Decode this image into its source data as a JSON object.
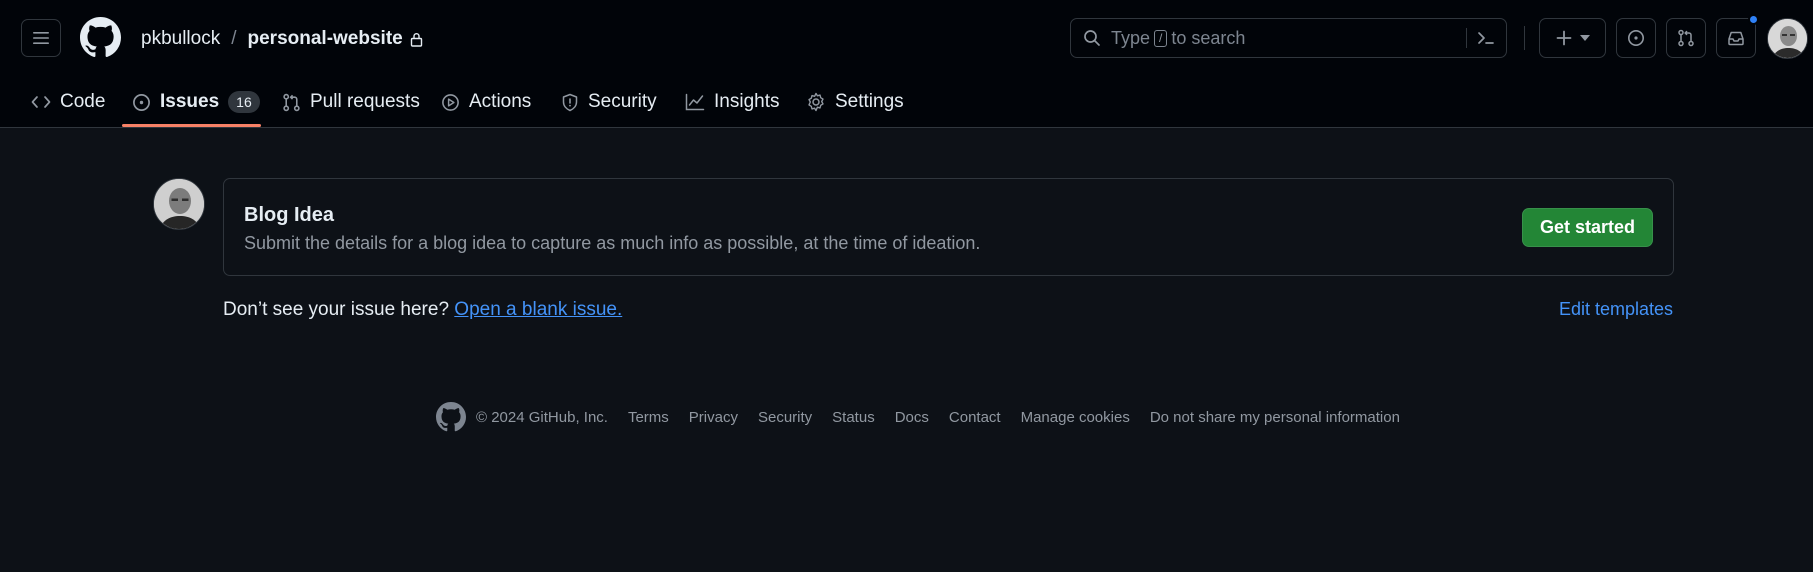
{
  "colors": {
    "header_bg": "#010409",
    "page_bg": "#0d1117",
    "border": "#30363d",
    "link": "#4493f8",
    "primary_button": "#238636",
    "active_tab_underline": "#f78166",
    "notification_dot": "#2f81f7"
  },
  "header": {
    "owner": "pkbullock",
    "separator": "/",
    "repo": "personal-website",
    "search": {
      "prefix": "Type",
      "key": "/",
      "suffix": "to search"
    }
  },
  "icons": {
    "menu": "hamburger-icon",
    "logo": "github-mark-icon",
    "lock": "lock-icon",
    "search": "search-icon",
    "command": "command-palette-icon",
    "create": "plus-icon",
    "issues": "issue-opened-icon",
    "pulls": "git-pull-request-icon",
    "inbox": "inbox-icon"
  },
  "tabs": [
    {
      "label": "Code",
      "icon": "code-icon"
    },
    {
      "label": "Issues",
      "icon": "issue-opened-icon",
      "count": "16",
      "active": true
    },
    {
      "label": "Pull requests",
      "icon": "git-pull-request-icon"
    },
    {
      "label": "Actions",
      "icon": "play-icon"
    },
    {
      "label": "Security",
      "icon": "shield-icon"
    },
    {
      "label": "Insights",
      "icon": "graph-icon"
    },
    {
      "label": "Settings",
      "icon": "gear-icon"
    }
  ],
  "template": {
    "title": "Blog Idea",
    "description": "Submit the details for a blog idea to capture as much info as possible, at the time of ideation.",
    "button": "Get started"
  },
  "blank_issue": {
    "prompt": "Don’t see your issue here?",
    "link": "Open a blank issue."
  },
  "edit_templates": "Edit templates",
  "footer": {
    "copyright": "© 2024 GitHub, Inc.",
    "links": [
      "Terms",
      "Privacy",
      "Security",
      "Status",
      "Docs",
      "Contact",
      "Manage cookies",
      "Do not share my personal information"
    ]
  }
}
